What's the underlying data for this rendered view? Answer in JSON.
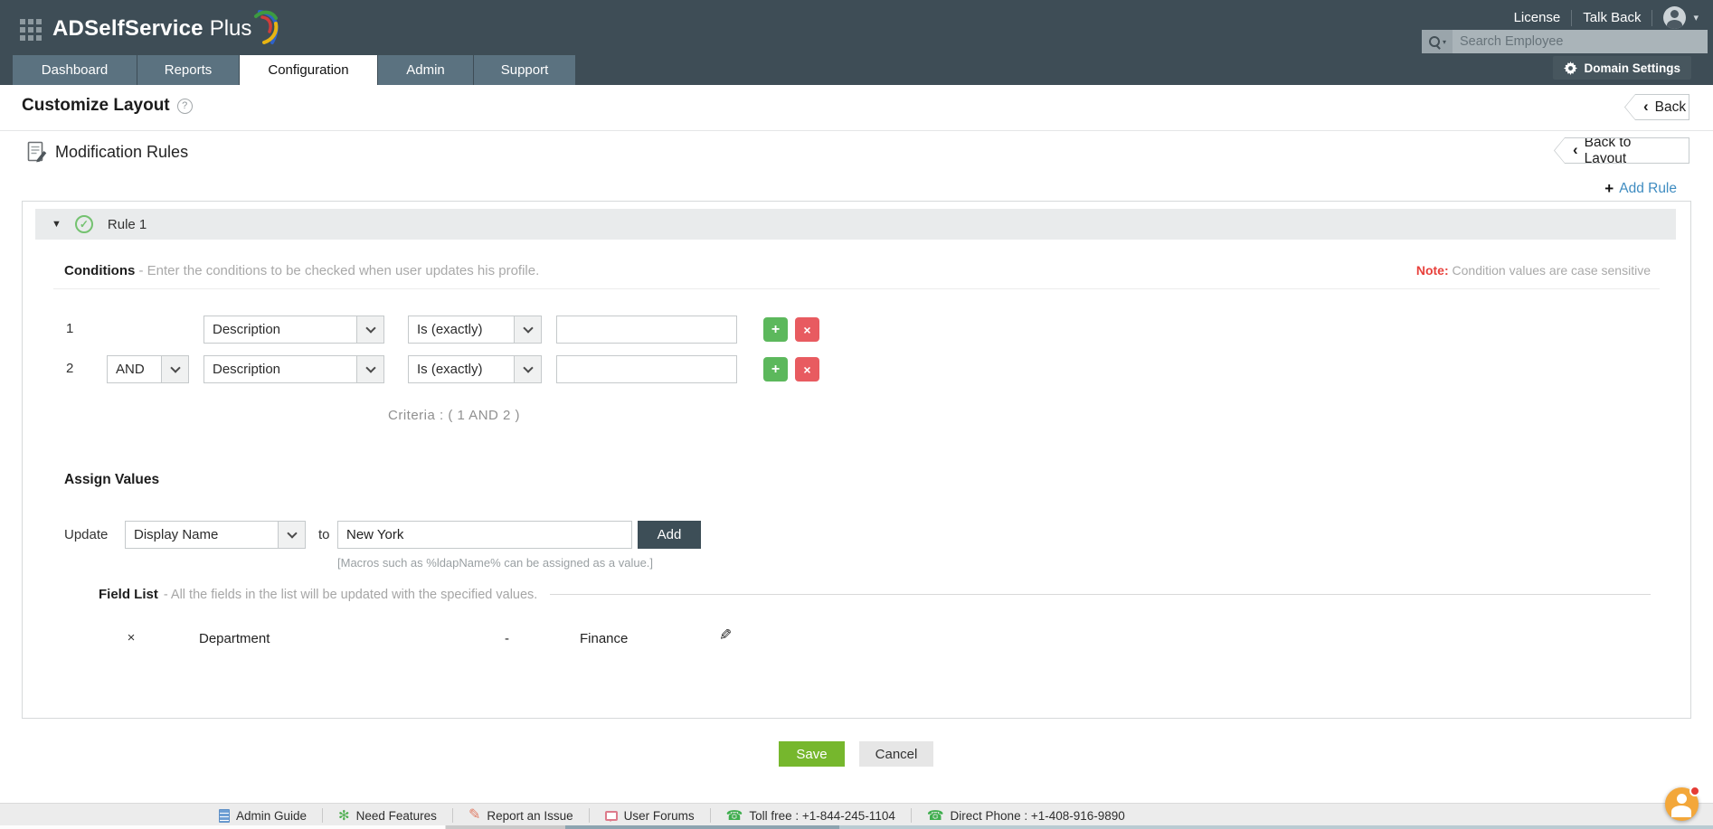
{
  "header": {
    "brand": {
      "bold": "ADSelfService",
      "light": "Plus"
    },
    "links": {
      "license": "License",
      "talkback": "Talk Back"
    },
    "search": {
      "placeholder": "Search Employee"
    },
    "tabs": [
      {
        "label": "Dashboard"
      },
      {
        "label": "Reports"
      },
      {
        "label": "Configuration"
      },
      {
        "label": "Admin"
      },
      {
        "label": "Support"
      }
    ],
    "domain_settings_label": "Domain Settings"
  },
  "page": {
    "title": "Customize Layout",
    "back_label": "Back",
    "section_title": "Modification Rules",
    "back_to_layout_label": "Back to Layout",
    "add_rule_label": "Add Rule"
  },
  "rule": {
    "title": "Rule 1",
    "conditions": {
      "heading": "Conditions",
      "description": "- Enter the conditions to be checked when user updates his profile.",
      "note_label": "Note:",
      "note_text": "Condition values are case sensitive",
      "rows": [
        {
          "index": "1",
          "logic": "",
          "field": "Description",
          "operator": "Is (exactly)",
          "value": ""
        },
        {
          "index": "2",
          "logic": "AND",
          "field": "Description",
          "operator": "Is (exactly)",
          "value": ""
        }
      ],
      "criteria": "Criteria : ( 1 AND 2 )"
    },
    "assign": {
      "heading": "Assign Values",
      "update_label": "Update",
      "field": "Display Name",
      "to_label": "to",
      "value": "New York",
      "add_label": "Add",
      "macro_hint": "[Macros such as %ldapName% can be assigned as a value.]",
      "field_list_heading": "Field List",
      "field_list_description": "- All the fields in the list will be updated with the specified values.",
      "rows": [
        {
          "remove": "×",
          "field": "Department",
          "separator": "-",
          "value": "Finance"
        }
      ]
    }
  },
  "actions": {
    "save": "Save",
    "cancel": "Cancel"
  },
  "footer": {
    "items": [
      {
        "label": "Admin Guide"
      },
      {
        "label": "Need Features"
      },
      {
        "label": "Report an Issue"
      },
      {
        "label": "User Forums"
      },
      {
        "label": "Toll free : +1-844-245-1104"
      },
      {
        "label": "Direct Phone : +1-408-916-9890"
      }
    ]
  },
  "icons": {
    "caret_down": "▼",
    "check": "✓",
    "back_chevron": "‹",
    "plus": "+",
    "close": "×",
    "help": "?",
    "dropdown_caret": "▾",
    "pencil": "✎",
    "phone": "☎",
    "asterisk": "✻"
  },
  "colors": {
    "header_bg": "#3e4d56",
    "tab_inactive": "#5b7280",
    "link_blue": "#3f8cc1",
    "note_red": "#e8413c",
    "add_green": "#5cb85c",
    "remove_red": "#e85b60",
    "save_green": "#76b72d",
    "add_btn_dark": "#3d4e57",
    "fab_orange": "#f3a73a"
  }
}
